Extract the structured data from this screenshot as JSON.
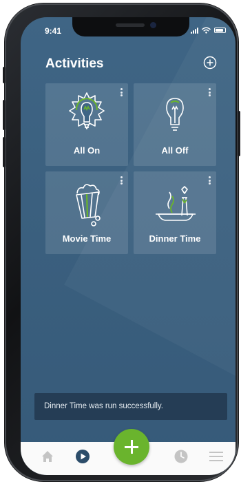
{
  "status_bar": {
    "time": "9:41"
  },
  "header": {
    "title": "Activities",
    "add_icon": "plus-circle-icon"
  },
  "activities": [
    {
      "label": "All On",
      "icon": "lightbulb-on-icon"
    },
    {
      "label": "All Off",
      "icon": "lightbulb-off-icon"
    },
    {
      "label": "Movie Time",
      "icon": "popcorn-icon"
    },
    {
      "label": "Dinner Time",
      "icon": "dinner-icon"
    }
  ],
  "toast": {
    "message": "Dinner Time was run successfully."
  },
  "tab_bar": {
    "items": [
      {
        "icon": "home-icon"
      },
      {
        "icon": "play-icon",
        "active": true
      },
      {
        "icon": "add-icon"
      },
      {
        "icon": "clock-icon"
      },
      {
        "icon": "menu-icon"
      }
    ]
  },
  "colors": {
    "background": "#3b607f",
    "accent_green": "#6ab42d",
    "active_tab": "#2c4d6a",
    "inactive_tab": "#c4c4c4",
    "toast_background": "#253d55"
  }
}
